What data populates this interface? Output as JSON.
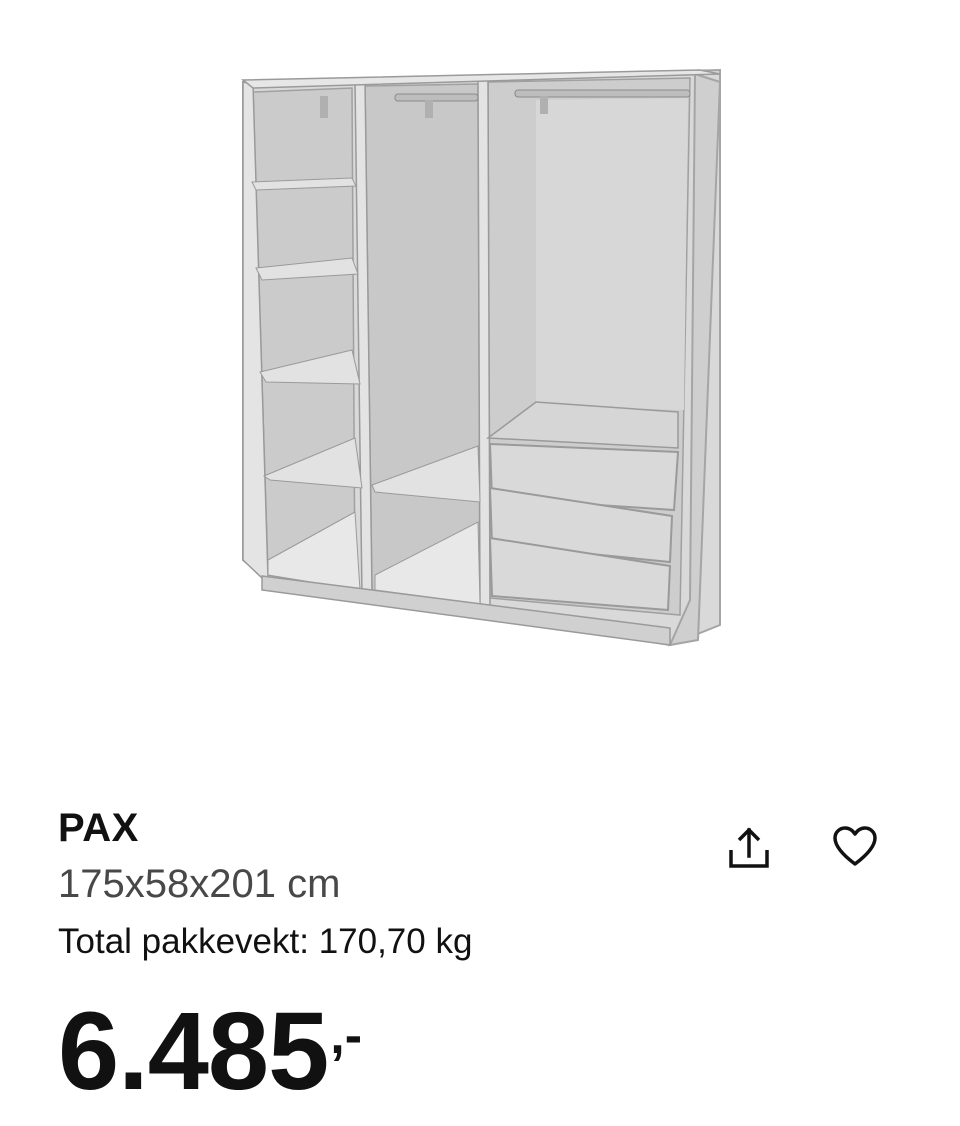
{
  "product": {
    "name": "PAX",
    "dimensions": "175x58x201 cm",
    "weight": "Total pakkevekt: 170,70 kg",
    "price_main": "6.485",
    "price_suffix": ",-"
  },
  "actions": {
    "share_icon": "share-icon",
    "favorite_icon": "heart-icon"
  },
  "colors": {
    "wardrobe_frame": "#d6d6d6",
    "wardrobe_edge": "#9a9a9a",
    "text_primary": "#111111",
    "text_secondary": "#484848"
  }
}
